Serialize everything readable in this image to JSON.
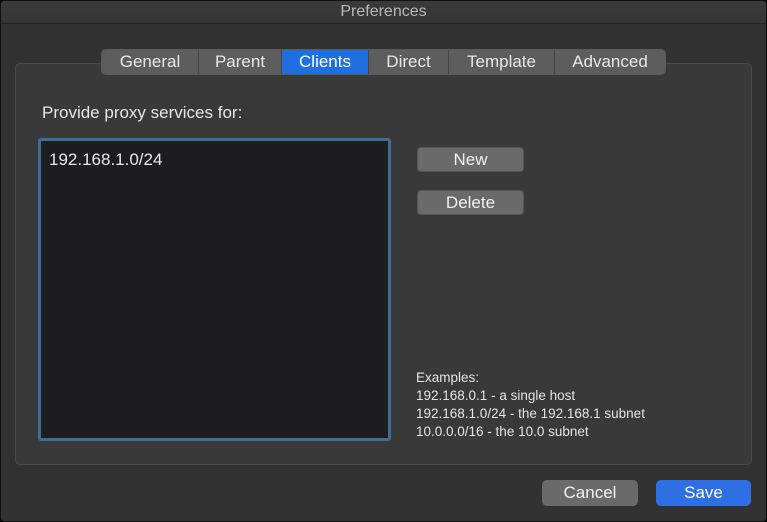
{
  "window": {
    "title": "Preferences"
  },
  "tabs": [
    {
      "label": "General"
    },
    {
      "label": "Parent"
    },
    {
      "label": "Clients"
    },
    {
      "label": "Direct"
    },
    {
      "label": "Template"
    },
    {
      "label": "Advanced"
    }
  ],
  "active_tab": "Clients",
  "clients": {
    "prompt": "Provide proxy services for:",
    "entries": [
      "192.168.1.0/24"
    ],
    "new_label": "New",
    "delete_label": "Delete",
    "examples": [
      "Examples:",
      "192.168.0.1 - a single host",
      "192.168.1.0/24 - the 192.168.1 subnet",
      "10.0.0.0/16 - the 10.0 subnet"
    ]
  },
  "footer": {
    "cancel_label": "Cancel",
    "save_label": "Save"
  },
  "colors": {
    "accent": "#1f6fe0",
    "save": "#2e6fe3",
    "focus_ring": "#3d6c97"
  }
}
